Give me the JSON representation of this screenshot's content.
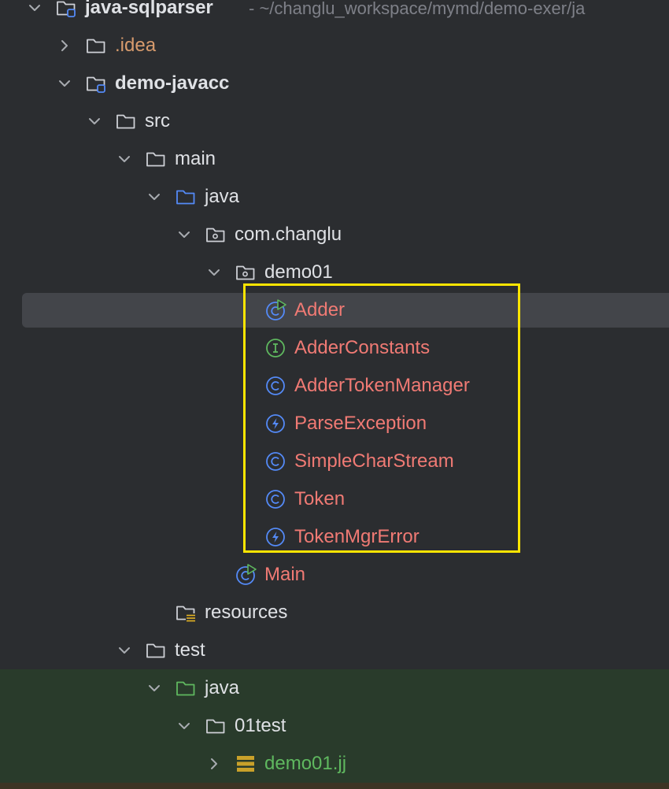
{
  "tree": {
    "root": {
      "label": "java-sqlparser",
      "path": "- ~/changlu_workspace/mymd/demo-exer/ja"
    },
    "idea": {
      "label": ".idea"
    },
    "module": {
      "label": "demo-javacc"
    },
    "src": {
      "label": "src"
    },
    "main": {
      "label": "main"
    },
    "main_java": {
      "label": "java"
    },
    "pkg": {
      "label": "com.changlu"
    },
    "demo01": {
      "label": "demo01"
    },
    "classes": [
      {
        "label": "Adder",
        "icon": "runnable-class-icon"
      },
      {
        "label": "AdderConstants",
        "icon": "interface-icon"
      },
      {
        "label": "AdderTokenManager",
        "icon": "class-icon"
      },
      {
        "label": "ParseException",
        "icon": "exception-icon"
      },
      {
        "label": "SimpleCharStream",
        "icon": "class-icon"
      },
      {
        "label": "Token",
        "icon": "class-icon"
      },
      {
        "label": "TokenMgrError",
        "icon": "exception-icon"
      }
    ],
    "main_class": {
      "label": "Main"
    },
    "resources": {
      "label": "resources"
    },
    "test": {
      "label": "test"
    },
    "test_java": {
      "label": "java"
    },
    "test_pkg": {
      "label": "01test"
    },
    "jj_file": {
      "label": "demo01.jj"
    }
  },
  "colors": {
    "background": "#2b2d30",
    "selection": "#43454a",
    "highlight_box": "#ffe500",
    "error_text": "#f07a74",
    "test_root_bg": "#293b2b"
  }
}
